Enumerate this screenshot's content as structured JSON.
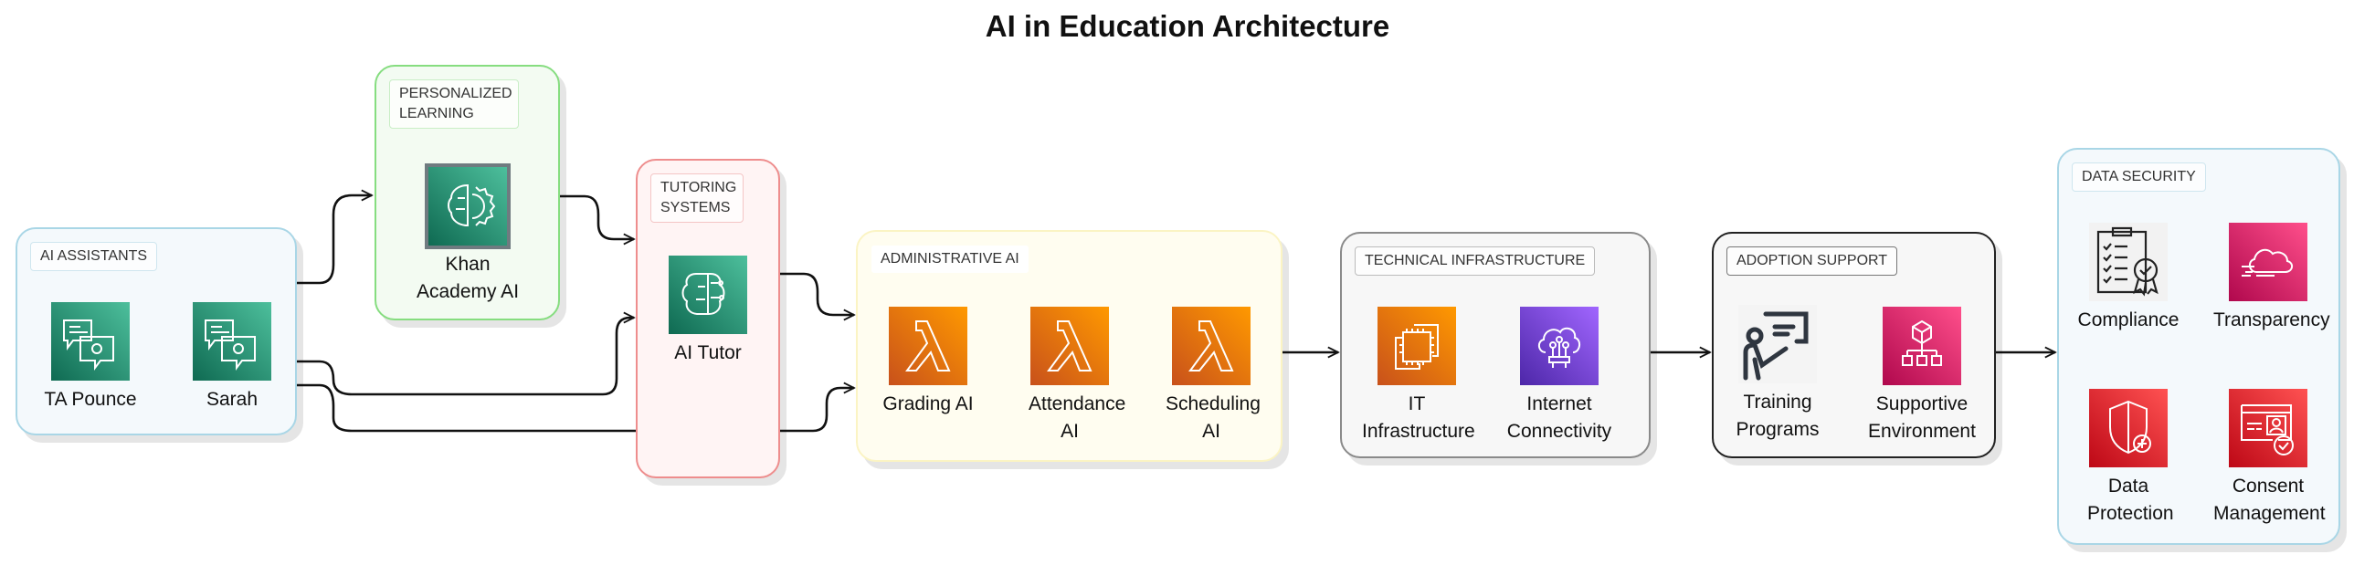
{
  "title": "AI in Education Architecture",
  "groups": {
    "ai_assistants": {
      "label": "AI ASSISTANTS",
      "border": "#9ccfe0",
      "fill": "#f4f9fc",
      "nodes": [
        {
          "label": "TA Pounce",
          "icon": "chatbot-icon"
        },
        {
          "label": "Sarah",
          "icon": "chatbot-icon"
        }
      ]
    },
    "personalized_learning": {
      "label": "PERSONALIZED LEARNING",
      "border": "#7fdc7a",
      "fill": "#f3fbf2",
      "nodes": [
        {
          "label": "Khan Academy AI",
          "icon": "brain-gear-icon"
        }
      ]
    },
    "tutoring_systems": {
      "label": "TUTORING SYSTEMS",
      "border": "#ee8a8a",
      "fill": "#fff4f4",
      "nodes": [
        {
          "label": "AI Tutor",
          "icon": "circuit-brain-icon"
        }
      ]
    },
    "administrative_ai": {
      "label": "ADMINISTRATIVE AI",
      "border": "#fbf6c9",
      "fill": "#fffdf0",
      "nodes": [
        {
          "label": "Grading AI",
          "icon": "lambda-icon"
        },
        {
          "label": "Attendance AI",
          "icon": "lambda-icon"
        },
        {
          "label": "Scheduling AI",
          "icon": "lambda-icon"
        }
      ]
    },
    "technical_infrastructure": {
      "label": "TECHNICAL INFRASTRUCTURE",
      "border": "#888888",
      "fill": "#f7f7f7",
      "nodes": [
        {
          "label": "IT Infrastructure",
          "icon": "compute-chip-icon"
        },
        {
          "label": "Internet Connectivity",
          "icon": "cloud-network-icon"
        }
      ]
    },
    "adoption_support": {
      "label": "ADOPTION SUPPORT",
      "border": "#222222",
      "fill": "#f7f7f7",
      "nodes": [
        {
          "label": "Training Programs",
          "icon": "presenter-icon"
        },
        {
          "label": "Supportive Environment",
          "icon": "hierarchy-cube-icon"
        }
      ]
    },
    "data_security": {
      "label": "DATA SECURITY",
      "border": "#9ccfe0",
      "fill": "#f4f9fc",
      "nodes": [
        {
          "label": "Compliance",
          "icon": "clipboard-certificate-icon"
        },
        {
          "label": "Transparency",
          "icon": "cloud-icon"
        },
        {
          "label": "Data Protection",
          "icon": "shield-plus-icon"
        },
        {
          "label": "Consent Management",
          "icon": "id-card-check-icon"
        }
      ]
    }
  },
  "edges": [
    {
      "from": "AI ASSISTANTS",
      "to": "PERSONALIZED LEARNING"
    },
    {
      "from": "AI ASSISTANTS",
      "to": "TUTORING SYSTEMS"
    },
    {
      "from": "AI ASSISTANTS",
      "to": "ADMINISTRATIVE AI"
    },
    {
      "from": "PERSONALIZED LEARNING",
      "to": "TUTORING SYSTEMS"
    },
    {
      "from": "TUTORING SYSTEMS",
      "to": "ADMINISTRATIVE AI"
    },
    {
      "from": "ADMINISTRATIVE AI",
      "to": "TECHNICAL INFRASTRUCTURE"
    },
    {
      "from": "TECHNICAL INFRASTRUCTURE",
      "to": "ADOPTION SUPPORT"
    },
    {
      "from": "ADOPTION SUPPORT",
      "to": "DATA SECURITY"
    }
  ],
  "colors": {
    "ml_green": "#1a7f64",
    "compute_orange": "#e8780f",
    "network_purple": "#6b3fd4",
    "app_pink": "#d6246a",
    "security_red": "#d42a2f"
  }
}
